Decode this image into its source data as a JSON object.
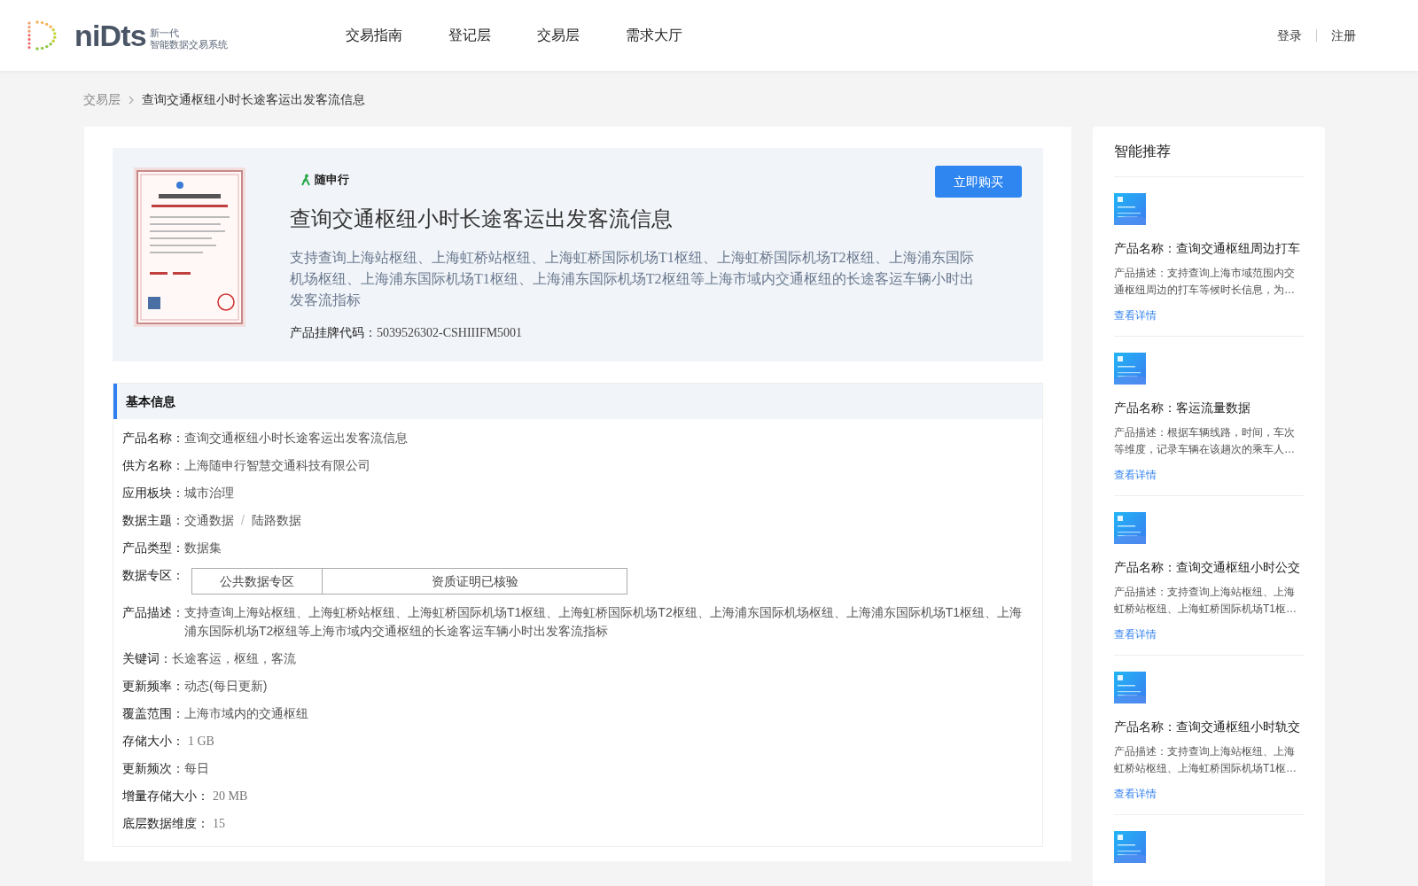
{
  "header": {
    "logo": {
      "wordmark": "niDts",
      "tagline_1": "新一代",
      "tagline_2": "智能数据交易系统"
    },
    "nav": [
      {
        "label": "交易指南",
        "selected": false
      },
      {
        "label": "登记层",
        "selected": false
      },
      {
        "label": "交易层",
        "selected": false
      },
      {
        "label": "需求大厅",
        "selected": false
      }
    ],
    "auth": [
      "登录",
      "注册"
    ]
  },
  "breadcrumb": [
    "交易层",
    "查询交通枢纽小时长途客运出发客流信息"
  ],
  "product": {
    "supplier_logo": "随申行",
    "buy_button": "立即购买",
    "title": "查询交通枢纽小时长途客运出发客流信息",
    "description": "支持查询上海站枢纽、上海虹桥站枢纽、上海虹桥国际机场T1枢纽、上海虹桥国际机场T2枢纽、上海浦东国际机场枢纽、上海浦东国际机场T1枢纽、上海浦东国际机场T2枢纽等上海市域内交通枢纽的长途客运车辆小时出发客流指标",
    "code_label": "产品挂牌代码：",
    "code": "5039526302-CSHIIIFM5001"
  },
  "basic_info": {
    "title": "基本信息",
    "rows": [
      {
        "kind": "text",
        "label": "产品名称：",
        "value": "查询交通枢纽小时长途客运出发客流信息"
      },
      {
        "kind": "text",
        "label": "供方名称：",
        "value": "上海随申行智慧交通科技有限公司"
      },
      {
        "kind": "text",
        "label": "应用板块：",
        "value": "城市治理"
      },
      {
        "kind": "path",
        "label": "数据主题：",
        "parts": [
          "交通数据",
          "陆路数据"
        ],
        "separator": "/"
      },
      {
        "kind": "text",
        "label": "产品类型：",
        "value": "数据集"
      },
      {
        "kind": "tags",
        "label": "数据专区：",
        "tags": [
          "公共数据专区",
          "资质证明已核验"
        ]
      },
      {
        "kind": "text",
        "label": "产品描述：",
        "value": "支持查询上海站枢纽、上海虹桥站枢纽、上海虹桥国际机场T1枢纽、上海虹桥国际机场T2枢纽、上海浦东国际机场枢纽、上海浦东国际机场T1枢纽、上海浦东国际机场T2枢纽等上海市域内交通枢纽的长途客运车辆小时出发客流指标"
      },
      {
        "kind": "text",
        "label": "关键词：",
        "value": "长途客运，枢纽，客流"
      },
      {
        "kind": "text",
        "label": "更新频率：",
        "value": "动态(每日更新)"
      },
      {
        "kind": "text",
        "label": "覆盖范围：",
        "value": "上海市域内的交通枢纽"
      },
      {
        "kind": "number",
        "label": "存储大小：",
        "value": "1 GB"
      },
      {
        "kind": "text",
        "label": "更新频次：",
        "value": "每日"
      },
      {
        "kind": "number",
        "label": "增量存储大小：",
        "value": "20 MB"
      },
      {
        "kind": "number",
        "label": "底层数据维度：",
        "value": "15"
      }
    ]
  },
  "recommend": {
    "title": "智能推荐",
    "items": [
      {
        "name": "产品名称：查询交通枢纽周边打车",
        "description": "产品描述：支持查询上海市域范围内交通枢纽周边的打车等候时长信息，为…",
        "link": "查看详情"
      },
      {
        "name": "产品名称：客运流量数据",
        "description": "产品描述：根据车辆线路，时间，车次等维度，记录车辆在该趟次的乘车人…",
        "link": "查看详情"
      },
      {
        "name": "产品名称：查询交通枢纽小时公交",
        "description": "产品描述：支持查询上海站枢纽、上海虹桥站枢纽、上海虹桥国际机场T1枢…",
        "link": "查看详情"
      },
      {
        "name": "产品名称：查询交通枢纽小时轨交",
        "description": "产品描述：支持查询上海站枢纽、上海虹桥站枢纽、上海虹桥国际机场T1枢…",
        "link": "查看详情"
      }
    ]
  }
}
